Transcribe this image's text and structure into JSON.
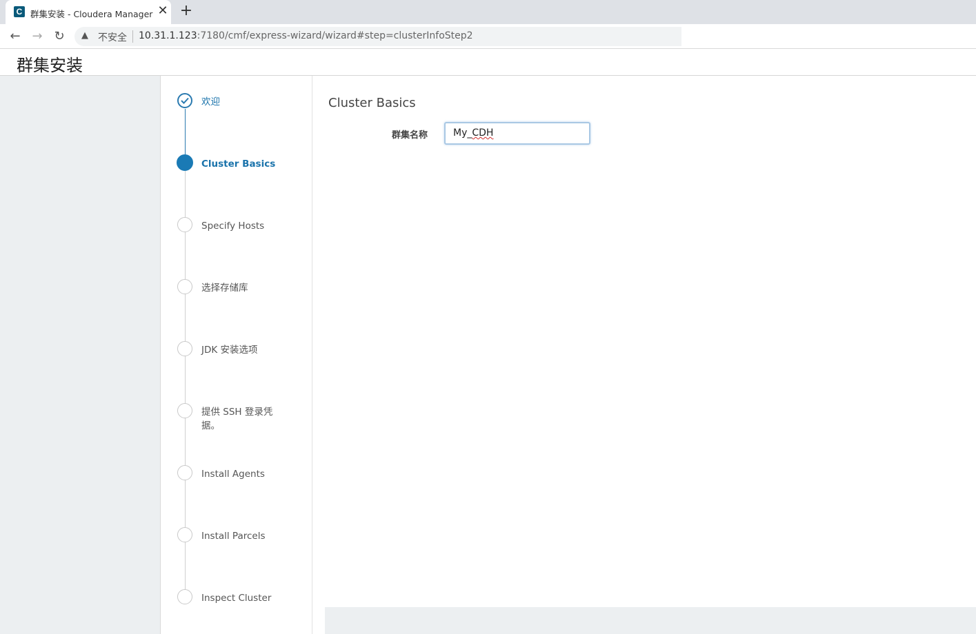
{
  "browser": {
    "tab": {
      "favicon": "C",
      "title": "群集安装 - Cloudera Manager",
      "close": "✕"
    },
    "new_tab": "+",
    "nav": {
      "back": "←",
      "forward": "→",
      "reload": "↻"
    },
    "address": {
      "security_text": "不安全",
      "host": "10.31.1.123",
      "path": ":7180/cmf/express-wizard/wizard#step=clusterInfoStep2"
    }
  },
  "page": {
    "title": "群集安装"
  },
  "steps": [
    {
      "label": "欢迎",
      "state": "done"
    },
    {
      "label": "Cluster Basics",
      "state": "active"
    },
    {
      "label": "Specify Hosts",
      "state": "pending"
    },
    {
      "label": "选择存储库",
      "state": "pending"
    },
    {
      "label": "JDK 安装选项",
      "state": "pending"
    },
    {
      "label": "提供 SSH 登录凭据。",
      "state": "pending"
    },
    {
      "label": "Install Agents",
      "state": "pending"
    },
    {
      "label": "Install Parcels",
      "state": "pending"
    },
    {
      "label": "Inspect Cluster",
      "state": "pending"
    }
  ],
  "main": {
    "section_title": "Cluster Basics",
    "cluster_name_label": "群集名称",
    "cluster_name_prefix": "My_",
    "cluster_name_suffix": "CDH"
  },
  "colors": {
    "accent": "#1a7ab5",
    "gutter": "#eceff1"
  }
}
